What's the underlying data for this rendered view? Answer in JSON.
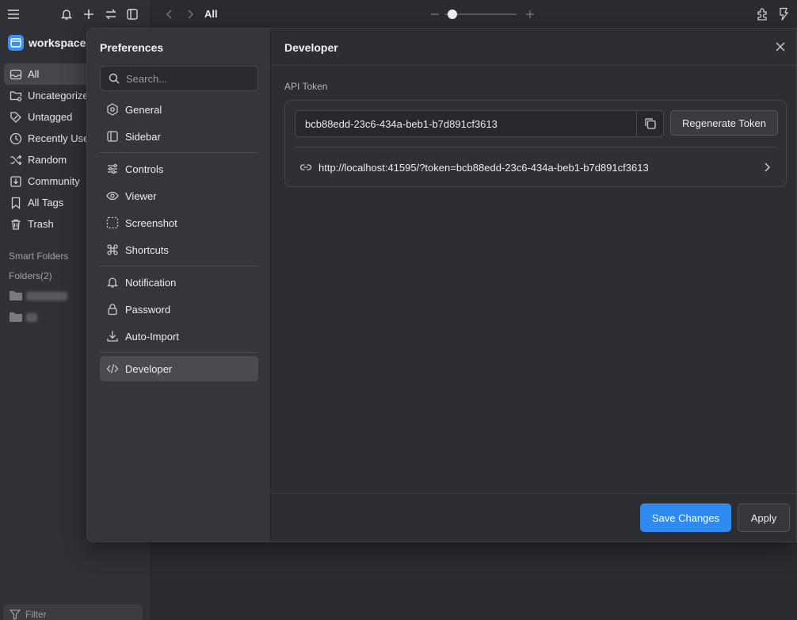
{
  "sidebar": {
    "workspace_name": "workspace",
    "nav_items": [
      {
        "label": "All",
        "icon": "inbox-icon"
      },
      {
        "label": "Uncategorized",
        "icon": "folder-unsorted-icon"
      },
      {
        "label": "Untagged",
        "icon": "tag-off-icon"
      },
      {
        "label": "Recently Used",
        "icon": "clock-icon"
      },
      {
        "label": "Random",
        "icon": "shuffle-icon"
      },
      {
        "label": "Community",
        "icon": "download-box-icon"
      },
      {
        "label": "All Tags",
        "icon": "bookmark-icon"
      },
      {
        "label": "Trash",
        "icon": "trash-icon"
      }
    ],
    "smart_folders_label": "Smart Folders",
    "folders_label": "Folders(2)",
    "filter_placeholder": "Filter"
  },
  "toolbar": {
    "breadcrumb": "All",
    "zoom_level": 0.1
  },
  "preferences": {
    "title": "Preferences",
    "search_placeholder": "Search...",
    "nav_groups": [
      [
        {
          "label": "General",
          "icon": "hexagon-icon"
        },
        {
          "label": "Sidebar",
          "icon": "sidebar-icon"
        }
      ],
      [
        {
          "label": "Controls",
          "icon": "sliders-icon"
        },
        {
          "label": "Viewer",
          "icon": "eye-icon"
        },
        {
          "label": "Screenshot",
          "icon": "screenshot-icon"
        },
        {
          "label": "Shortcuts",
          "icon": "command-icon"
        }
      ],
      [
        {
          "label": "Notification",
          "icon": "bell-icon"
        },
        {
          "label": "Password",
          "icon": "lock-icon"
        },
        {
          "label": "Auto-Import",
          "icon": "download-icon"
        }
      ],
      [
        {
          "label": "Developer",
          "icon": "code-icon",
          "active": true
        }
      ]
    ],
    "content": {
      "title": "Developer",
      "api_token_label": "API Token",
      "api_token_value": "bcb88edd-23c6-434a-beb1-b7d891cf3613",
      "regenerate_label": "Regenerate Token",
      "api_url": "http://localhost:41595/?token=bcb88edd-23c6-434a-beb1-b7d891cf3613"
    },
    "footer": {
      "save_label": "Save Changes",
      "apply_label": "Apply"
    }
  },
  "colors": {
    "accent": "#2f8af0",
    "background": "#2b2c30",
    "sidebar": "#303136",
    "modal_nav": "#35363b"
  }
}
